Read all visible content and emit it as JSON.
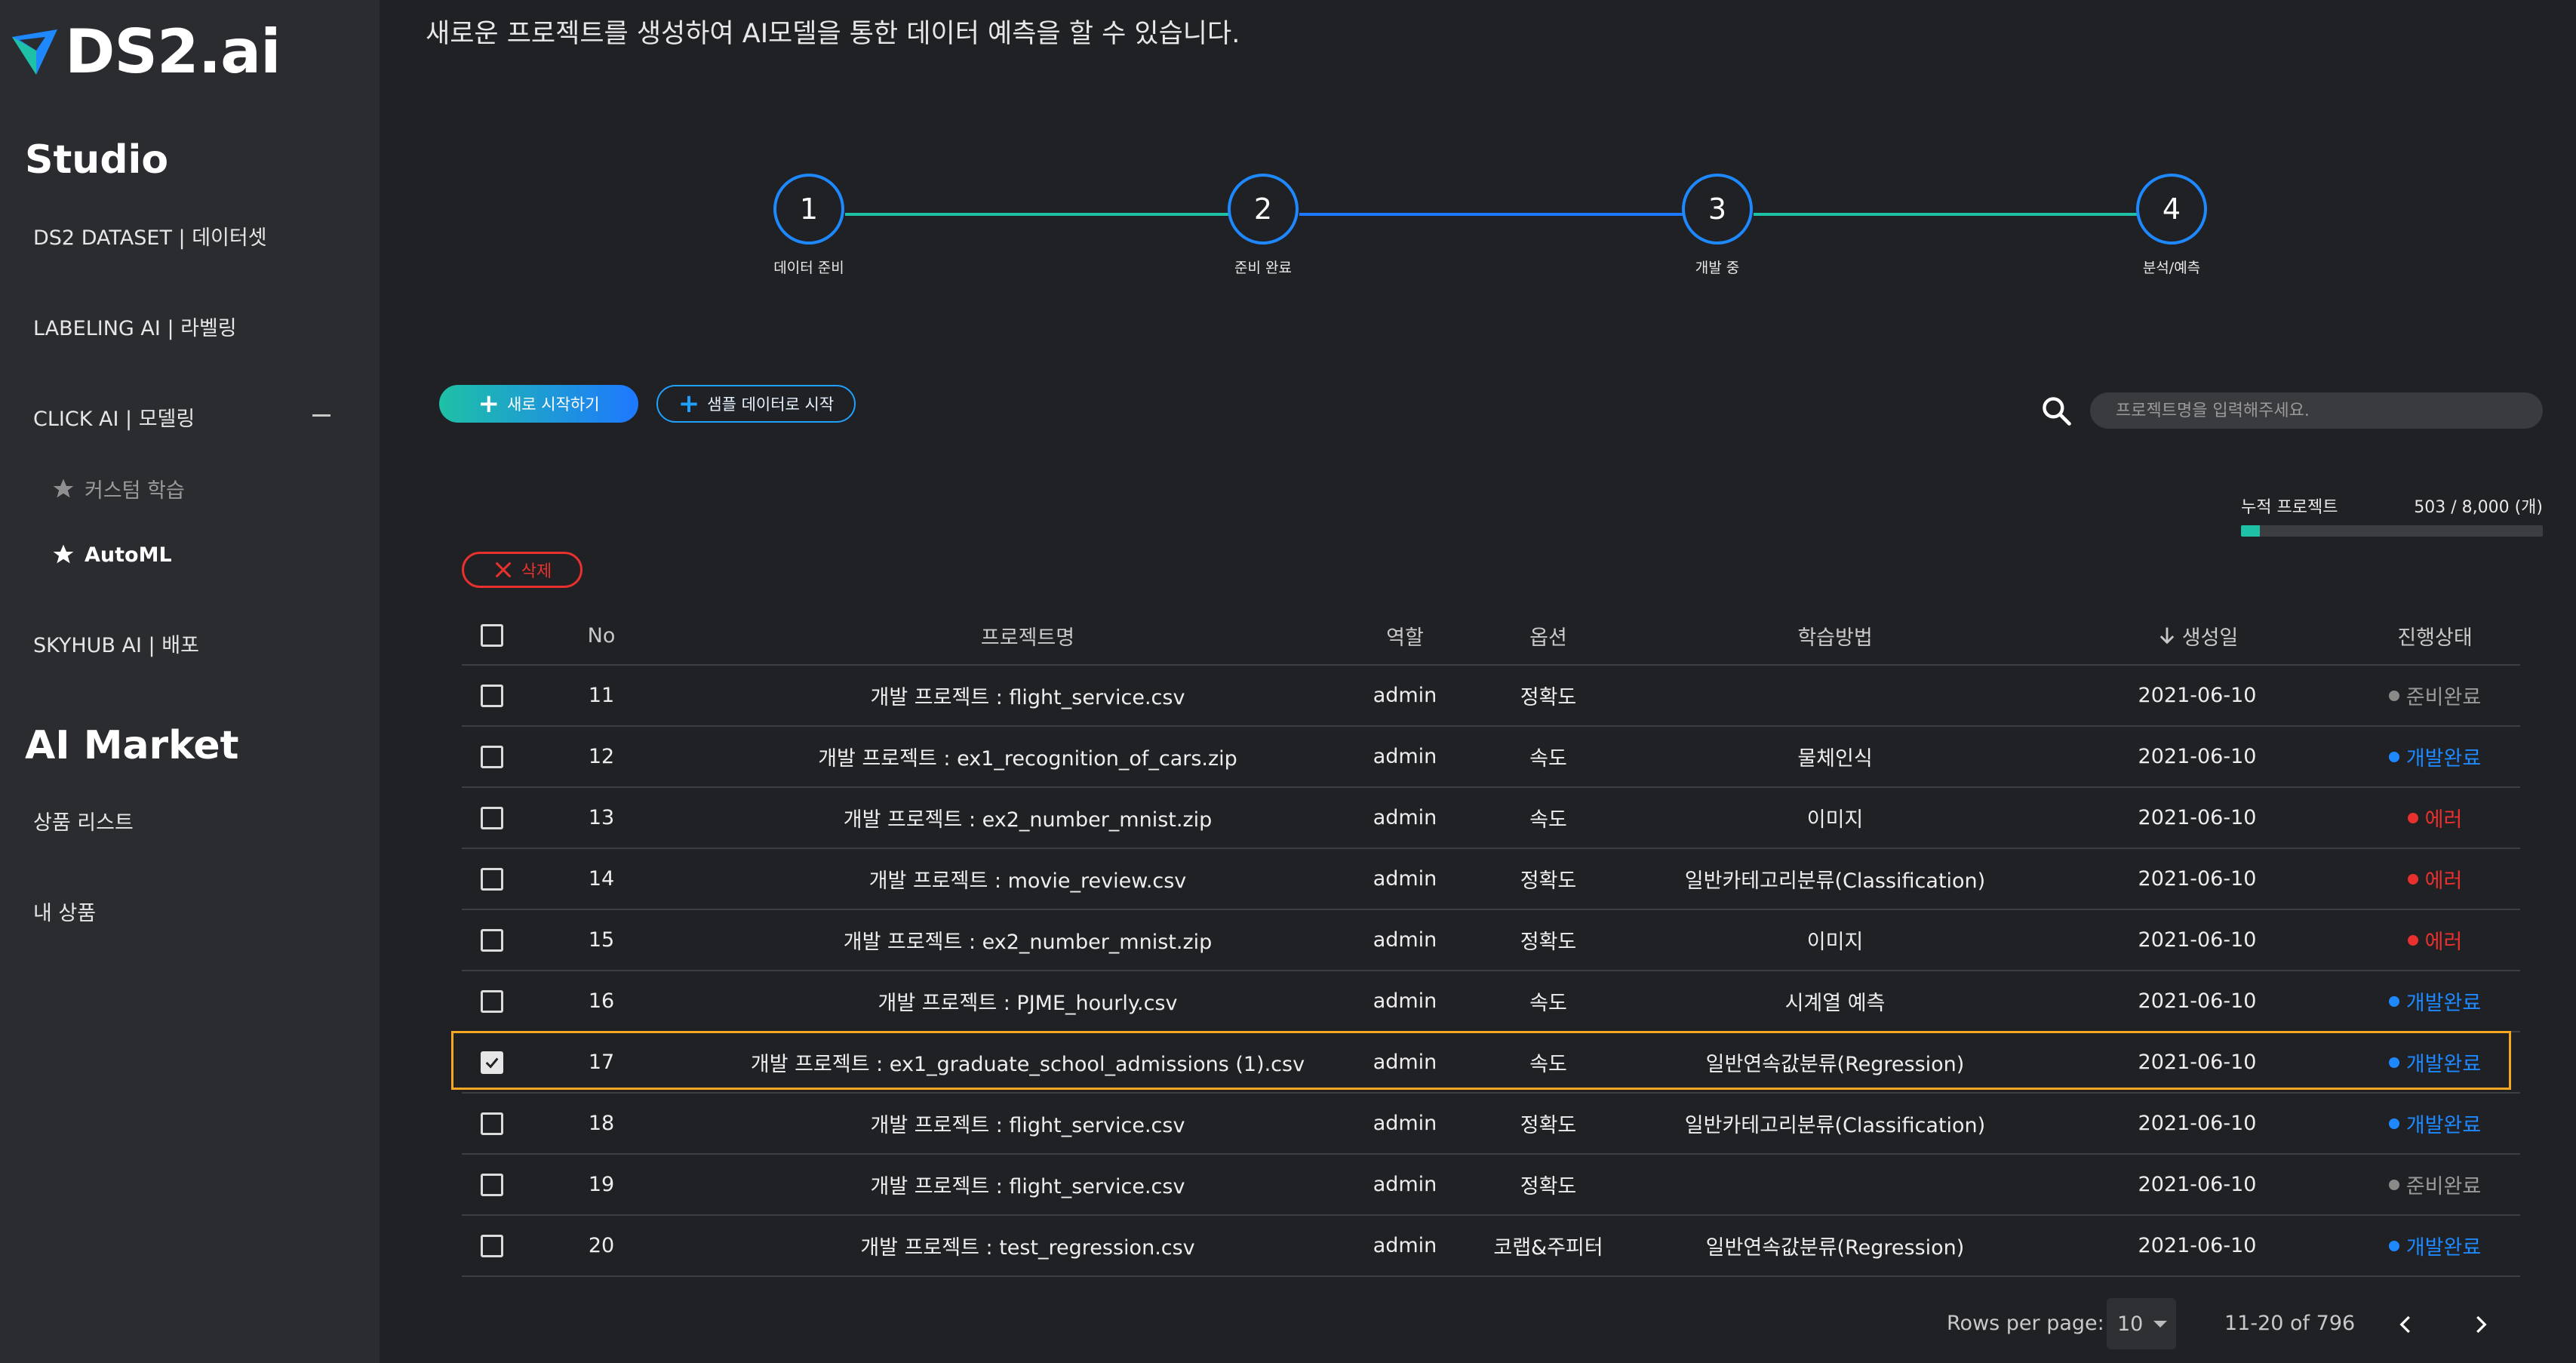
{
  "sidebar": {
    "logo": "DS2.ai",
    "studio_title": "Studio",
    "items": [
      {
        "label": "DS2 DATASET | 데이터셋"
      },
      {
        "label": "LABELING AI | 라벨링"
      },
      {
        "label": "CLICK AI | 모델링"
      },
      {
        "label": "SKYHUB AI | 배포"
      }
    ],
    "subitems": [
      {
        "label": "커스텀 학습"
      },
      {
        "label": "AutoML"
      }
    ],
    "market_title": "AI Market",
    "market_items": [
      {
        "label": "상품 리스트"
      },
      {
        "label": "내 상품"
      }
    ]
  },
  "intro": "새로운 프로젝트를 생성하여 AI모델을 통한 데이터 예측을 할 수 있습니다.",
  "steps": [
    {
      "num": "1",
      "label": "데이터 준비"
    },
    {
      "num": "2",
      "label": "준비 완료"
    },
    {
      "num": "3",
      "label": "개발 중"
    },
    {
      "num": "4",
      "label": "분석/예측"
    }
  ],
  "buttons": {
    "new_label": "새로 시작하기",
    "sample_label": "샘플 데이터로 시작",
    "delete_label": "삭제"
  },
  "search": {
    "placeholder": "프로젝트명을 입력해주세요."
  },
  "cumulative": {
    "label": "누적 프로젝트",
    "value": "503 / 8,000 (개)",
    "fraction": 0.063
  },
  "table": {
    "headers": {
      "no": "No",
      "name": "프로젝트명",
      "role": "역할",
      "option": "옵션",
      "method": "학습방법",
      "date": "생성일",
      "status": "진행상태"
    },
    "rows": [
      {
        "no": "11",
        "name": "개발 프로젝트 : flight_service.csv",
        "role": "admin",
        "option": "정확도",
        "method": "",
        "date": "2021-06-10",
        "status": "준비완료",
        "status_color": "#8a8a8a",
        "checked": false
      },
      {
        "no": "12",
        "name": "개발 프로젝트 : ex1_recognition_of_cars.zip",
        "role": "admin",
        "option": "속도",
        "method": "물체인식",
        "date": "2021-06-10",
        "status": "개발완료",
        "status_color": "#1e88ff",
        "checked": false
      },
      {
        "no": "13",
        "name": "개발 프로젝트 : ex2_number_mnist.zip",
        "role": "admin",
        "option": "속도",
        "method": "이미지",
        "date": "2021-06-10",
        "status": "에러",
        "status_color": "#e8312f",
        "checked": false
      },
      {
        "no": "14",
        "name": "개발 프로젝트 : movie_review.csv",
        "role": "admin",
        "option": "정확도",
        "method": "일반카테고리분류(Classification)",
        "date": "2021-06-10",
        "status": "에러",
        "status_color": "#e8312f",
        "checked": false
      },
      {
        "no": "15",
        "name": "개발 프로젝트 : ex2_number_mnist.zip",
        "role": "admin",
        "option": "정확도",
        "method": "이미지",
        "date": "2021-06-10",
        "status": "에러",
        "status_color": "#e8312f",
        "checked": false
      },
      {
        "no": "16",
        "name": "개발 프로젝트 : PJME_hourly.csv",
        "role": "admin",
        "option": "속도",
        "method": "시계열 예측",
        "date": "2021-06-10",
        "status": "개발완료",
        "status_color": "#1e88ff",
        "checked": false
      },
      {
        "no": "17",
        "name": "개발 프로젝트 : ex1_graduate_school_admissions (1).csv",
        "role": "admin",
        "option": "속도",
        "method": "일반연속값분류(Regression)",
        "date": "2021-06-10",
        "status": "개발완료",
        "status_color": "#1e88ff",
        "checked": true
      },
      {
        "no": "18",
        "name": "개발 프로젝트 : flight_service.csv",
        "role": "admin",
        "option": "정확도",
        "method": "일반카테고리분류(Classification)",
        "date": "2021-06-10",
        "status": "개발완료",
        "status_color": "#1e88ff",
        "checked": false
      },
      {
        "no": "19",
        "name": "개발 프로젝트 : flight_service.csv",
        "role": "admin",
        "option": "정확도",
        "method": "",
        "date": "2021-06-10",
        "status": "준비완료",
        "status_color": "#8a8a8a",
        "checked": false
      },
      {
        "no": "20",
        "name": "개발 프로젝트 : test_regression.csv",
        "role": "admin",
        "option": "코랩&주피터",
        "method": "일반연속값분류(Regression)",
        "date": "2021-06-10",
        "status": "개발완료",
        "status_color": "#1e88ff",
        "checked": false
      }
    ]
  },
  "pagination": {
    "rows_per_page_label": "Rows per page:",
    "rows_per_page": "10",
    "range": "11-20 of 796"
  },
  "colors": {
    "accent_blue": "#1e88ff",
    "accent_teal": "#1ec1a6",
    "error_red": "#e8312f",
    "highlight_orange": "#f5a623"
  }
}
